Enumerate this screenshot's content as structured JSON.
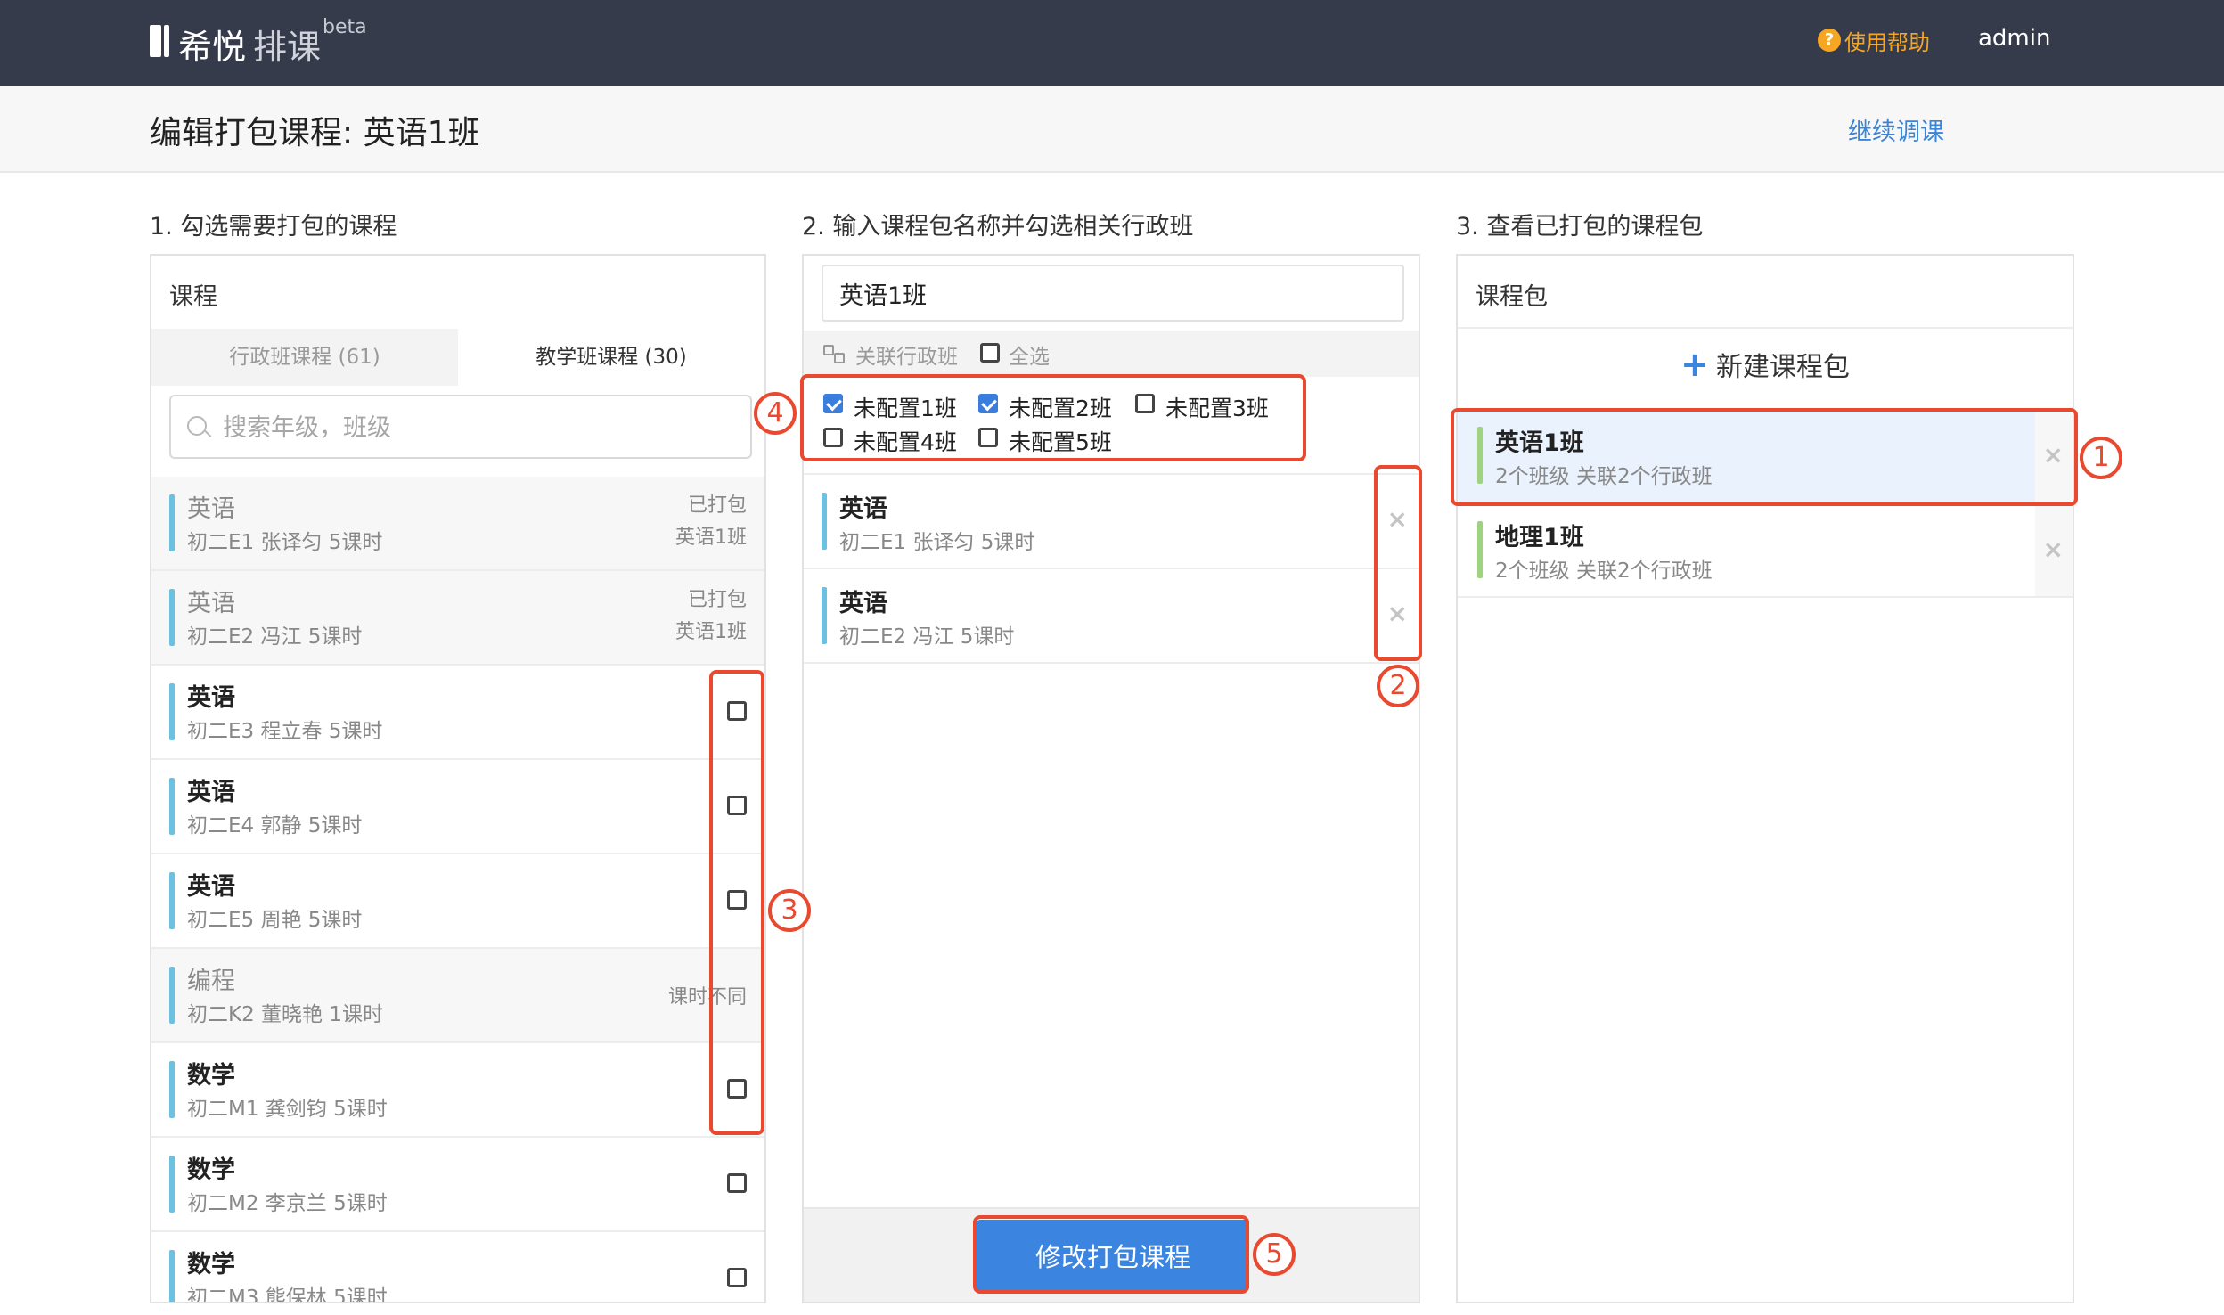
{
  "nav": {
    "brand": "希悦",
    "product": "排课",
    "badge": "beta",
    "help_icon": "?",
    "help": "使用帮助",
    "user": "admin"
  },
  "header": {
    "title": "编辑打包课程: 英语1班",
    "continue_link": "继续调课"
  },
  "col1": {
    "heading": "1. 勾选需要打包的课程",
    "panel_title": "课程",
    "tabs": [
      "行政班课程 (61)",
      "教学班课程 (30)"
    ],
    "active_tab": 1,
    "search_placeholder": "搜索年级，班级",
    "courses": [
      {
        "name": "英语",
        "meta": "初二E1 张译匀 5课时",
        "status1": "已打包",
        "status2": "英语1班",
        "disabled": true
      },
      {
        "name": "英语",
        "meta": "初二E2 冯江 5课时",
        "status1": "已打包",
        "status2": "英语1班",
        "disabled": true
      },
      {
        "name": "英语",
        "meta": "初二E3 程立春 5课时",
        "checked": false
      },
      {
        "name": "英语",
        "meta": "初二E4 郭静 5课时",
        "checked": false
      },
      {
        "name": "英语",
        "meta": "初二E5 周艳 5课时",
        "checked": false
      },
      {
        "name": "编程",
        "meta": "初二K2 董晓艳 1课时",
        "status_mid": "课时不同",
        "disabled": true
      },
      {
        "name": "数学",
        "meta": "初二M1 龚剑钧 5课时",
        "checked": false
      },
      {
        "name": "数学",
        "meta": "初二M2 李京兰 5课时",
        "checked": false
      },
      {
        "name": "数学",
        "meta": "初二M3 熊保林 5课时",
        "checked": false
      }
    ]
  },
  "col2": {
    "heading": "2. 输入课程包名称并勾选相关行政班",
    "package_name": "英语1班",
    "link_label": "关联行政班",
    "select_all": "全选",
    "classes": [
      {
        "label": "未配置1班",
        "checked": true
      },
      {
        "label": "未配置2班",
        "checked": true
      },
      {
        "label": "未配置3班",
        "checked": false
      },
      {
        "label": "未配置4班",
        "checked": false
      },
      {
        "label": "未配置5班",
        "checked": false
      }
    ],
    "selected_courses": [
      {
        "name": "英语",
        "meta": "初二E1 张译匀 5课时"
      },
      {
        "name": "英语",
        "meta": "初二E2 冯江 5课时"
      }
    ],
    "remove_glyph": "×",
    "submit": "修改打包课程"
  },
  "col3": {
    "heading": "3. 查看已打包的课程包",
    "panel_title": "课程包",
    "new_plus": "+",
    "new_package": "新建课程包",
    "packages": [
      {
        "name": "英语1班",
        "meta": "2个班级 关联2个行政班",
        "selected": true
      },
      {
        "name": "地理1班",
        "meta": "2个班级 关联2个行政班",
        "selected": false
      }
    ]
  },
  "annotations": {
    "n1": "1",
    "n2": "2",
    "n3": "3",
    "n4": "4",
    "n5": "5"
  },
  "colors": {
    "accent": "#3b84e0",
    "annotation": "#e9492e",
    "nav_bg": "#363b4c",
    "course_bar": "#6cc0e0",
    "package_bar": "#9fd37f"
  }
}
